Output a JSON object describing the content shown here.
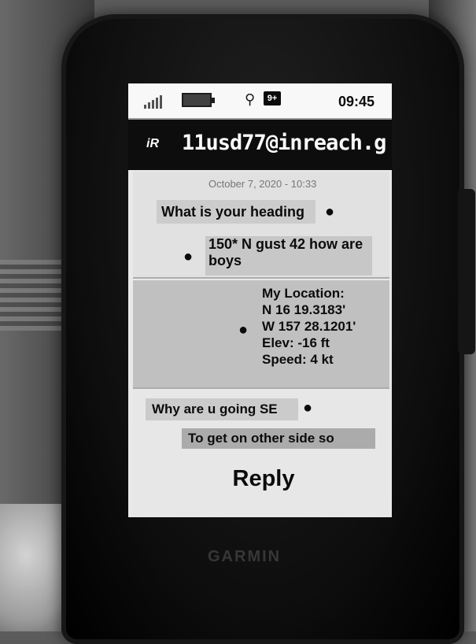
{
  "status_bar": {
    "signal_icon": "signal-bars-icon",
    "battery_icon": "battery-icon",
    "gps_icon": "gps-satellite-icon",
    "message_icon": "message-notification-icon",
    "message_icon_glyph": "9+",
    "time": "09:45"
  },
  "title_bar": {
    "app_logo": "iR",
    "contact": "11usd77@inreach.g"
  },
  "conversation": {
    "date": "October 7, 2020 - 10:33",
    "messages": [
      {
        "direction": "incoming",
        "text": "What is your heading"
      },
      {
        "direction": "outgoing",
        "text": "150* N gust 42 how are boys"
      },
      {
        "direction": "outgoing",
        "type": "location",
        "lines": [
          "My Location:",
          "N 16 19.3183'",
          "W 157 28.1201'",
          "Elev: -16 ft",
          "Speed: 4 kt"
        ]
      },
      {
        "direction": "incoming",
        "text": "Why are u going SE"
      },
      {
        "direction": "outgoing",
        "text": "To get on other side so"
      }
    ]
  },
  "reply_label": "Reply",
  "device_brand": "GARMIN"
}
